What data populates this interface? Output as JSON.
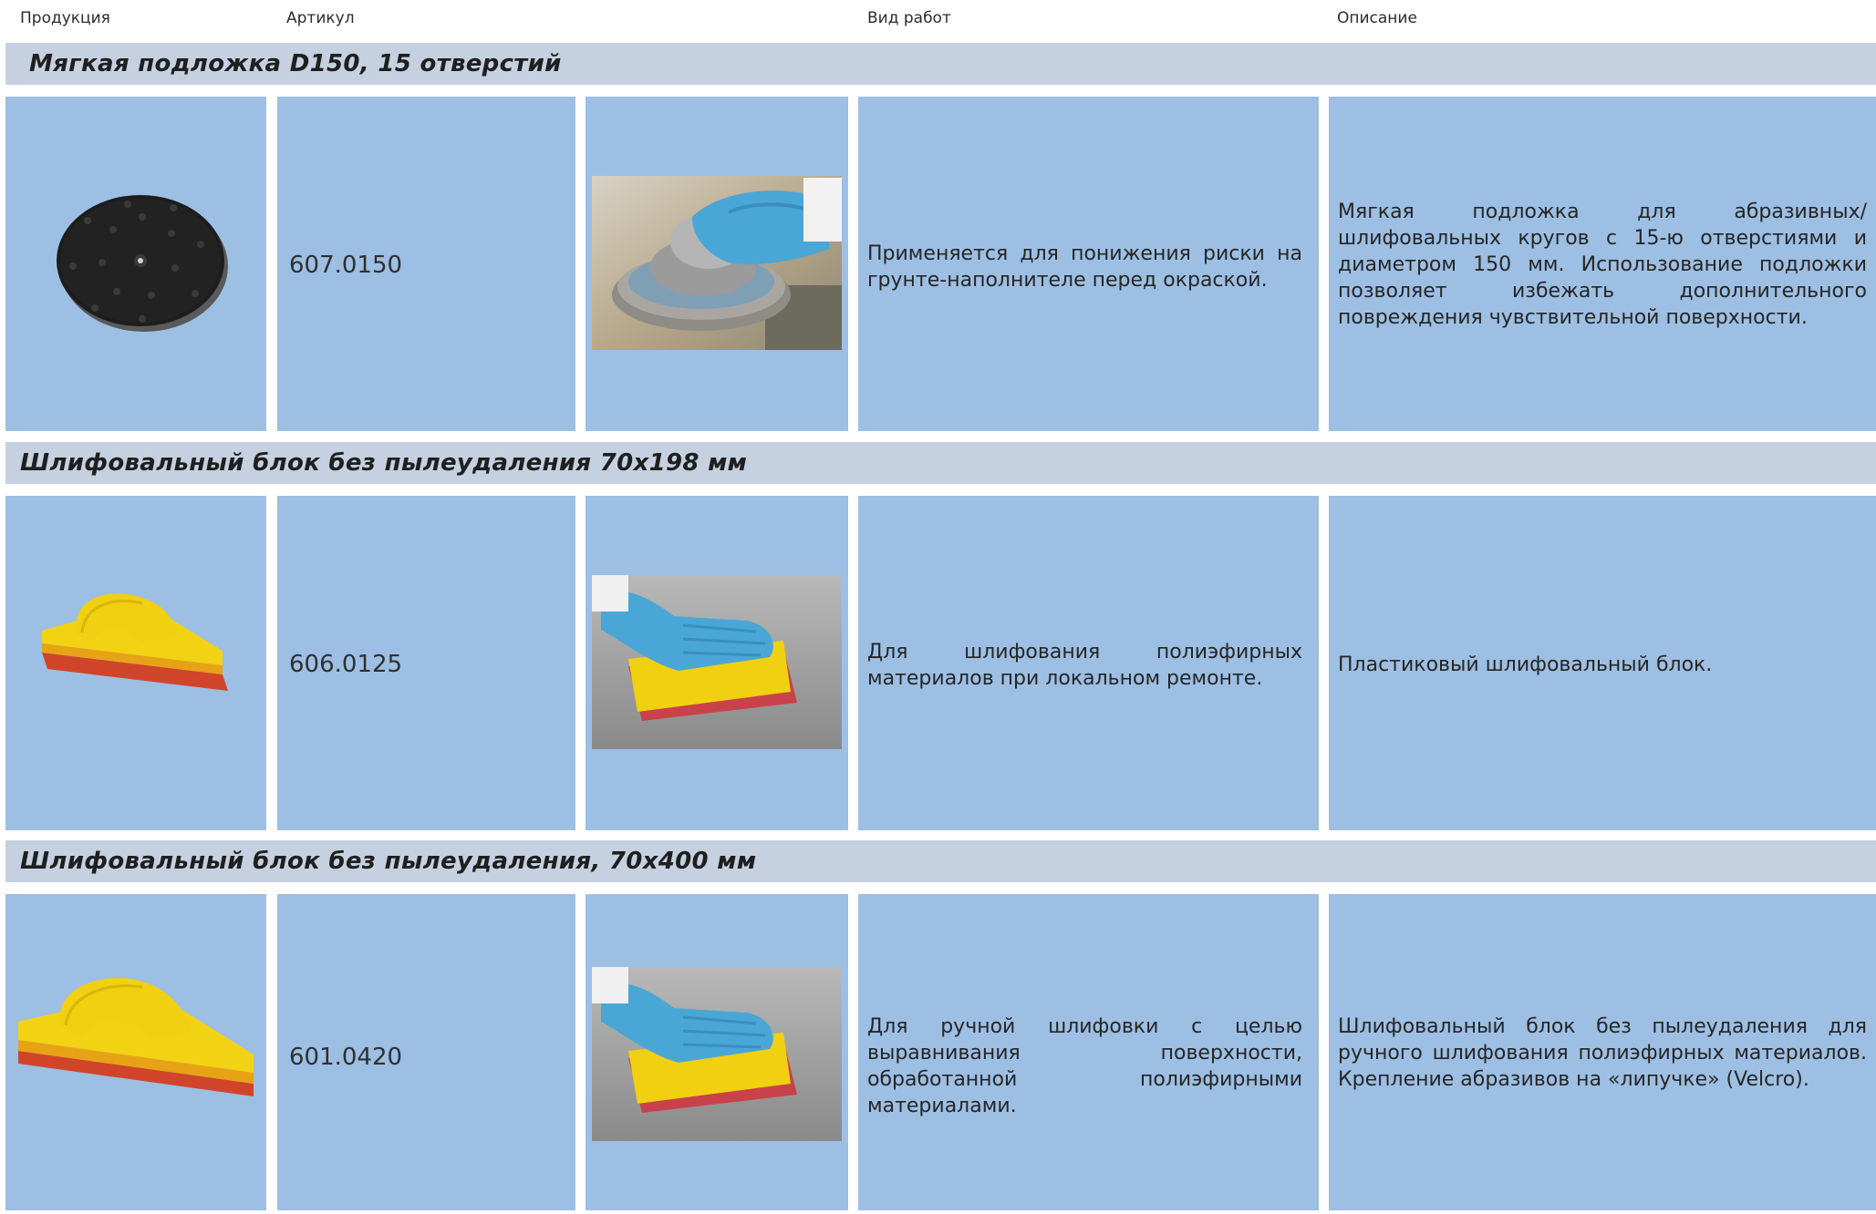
{
  "header": {
    "product": "Продукция",
    "article": "Артикул",
    "work_type": "Вид работ",
    "description": "Описание"
  },
  "rows": [
    {
      "title": "Мягкая подложка D150, 15 отверстий",
      "code": "607.0150",
      "work_type": "Применяется для понижения риски на грунте-наполнителе перед окраской.",
      "description": "Мягкая подложка для абразивных/шлифовальных кругов с 15-ю отверстиями и диаметром 150 мм. Использование подложки позволяет избежать дополнительного повреждения чувствительной поверхности."
    },
    {
      "title": "Шлифовальный блок без пылеудаления 70x198 мм",
      "code": "606.0125",
      "work_type": "Для шлифования полиэфирных материалов при локальном ремонте.",
      "description": "Пластиковый шлифовальный блок."
    },
    {
      "title": "Шлифовальный блок без пылеудаления, 70x400 мм",
      "code": "601.0420",
      "work_type": "Для ручной шлифовки с целью выравнивания поверхности, обработанной полиэфирными материалами.",
      "description": "Шлифовальный блок без пылеудаления для ручного шлифования полиэфирных материалов. Крепление абразивов на «липучке» (Velcro)."
    }
  ],
  "colors": {
    "band": "#c5d1e0",
    "cell": "#9dbfe3",
    "glove": "#4aa6d6",
    "block_yellow": "#f2d313",
    "block_red": "#d0452a",
    "pad_black": "#1d1d1d"
  }
}
